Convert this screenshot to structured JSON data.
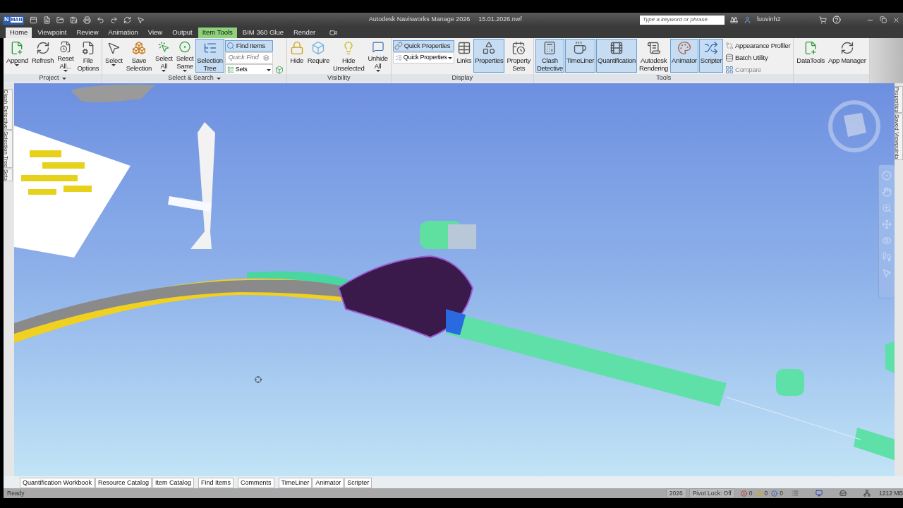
{
  "app_button": {
    "letter": "N",
    "edition": "MAN"
  },
  "window": {
    "title": "Autodesk Navisworks Manage 2026",
    "file": "15.01.2026.nwf"
  },
  "search": {
    "placeholder": "Type a keyword or phrase"
  },
  "user": {
    "name": "luuvinh2"
  },
  "tabs": [
    {
      "label": "Home",
      "selected": true,
      "kind": "normal"
    },
    {
      "label": "Viewpoint",
      "selected": false,
      "kind": "normal"
    },
    {
      "label": "Review",
      "selected": false,
      "kind": "normal"
    },
    {
      "label": "Animation",
      "selected": false,
      "kind": "normal"
    },
    {
      "label": "View",
      "selected": false,
      "kind": "normal"
    },
    {
      "label": "Output",
      "selected": false,
      "kind": "normal"
    },
    {
      "label": "Item Tools",
      "selected": false,
      "kind": "contextual"
    },
    {
      "label": "BIM 360 Glue",
      "selected": false,
      "kind": "normal"
    },
    {
      "label": "Render",
      "selected": false,
      "kind": "normal"
    }
  ],
  "ribbon_panels": [
    {
      "title": "Project",
      "menu": true,
      "items": [
        {
          "kind": "large",
          "label": "Append",
          "caret": true,
          "selected": false
        },
        {
          "kind": "large",
          "label": "Refresh",
          "selected": false
        },
        {
          "kind": "large",
          "label": "Reset\nAll...",
          "caret": true,
          "selected": false
        },
        {
          "kind": "large",
          "label": "File\nOptions",
          "selected": false
        }
      ]
    },
    {
      "title": "Select & Search",
      "menu": true,
      "items": [
        {
          "kind": "large",
          "label": "Select",
          "caret": true,
          "selected": false
        },
        {
          "kind": "large",
          "label": "Save\nSelection",
          "selected": false
        },
        {
          "kind": "large",
          "label": "Select\nAll",
          "caret": true,
          "selected": false
        },
        {
          "kind": "large",
          "label": "Select\nSame",
          "caret": true,
          "selected": false
        },
        {
          "kind": "large",
          "label": "Selection\nTree",
          "selected": true
        },
        {
          "kind": "stack",
          "items": [
            {
              "kind": "small",
              "label": "Find Items",
              "selected": true
            },
            {
              "kind": "field",
              "placeholder": "Quick Find"
            },
            {
              "kind": "dropdown",
              "label": "Sets"
            }
          ]
        },
        {
          "kind": "stack",
          "items": [
            {
              "kind": "spacer"
            },
            {
              "kind": "spacer"
            },
            {
              "kind": "icon"
            }
          ]
        }
      ]
    },
    {
      "title": "Visibility",
      "menu": false,
      "items": [
        {
          "kind": "large",
          "label": "Hide",
          "selected": false
        },
        {
          "kind": "large",
          "label": "Require",
          "selected": false
        },
        {
          "kind": "large",
          "label": "Hide\nUnselected",
          "selected": false
        },
        {
          "kind": "large",
          "label": "Unhide\nAll",
          "caret": true,
          "selected": false
        }
      ]
    },
    {
      "title": "Display",
      "menu": false,
      "items": [
        {
          "kind": "stack",
          "items": [
            {
              "kind": "small",
              "label": "Quick Properties",
              "selected": true
            },
            {
              "kind": "dropdown",
              "label": "Quick Properties"
            }
          ]
        },
        {
          "kind": "large",
          "label": "Links",
          "selected": false
        },
        {
          "kind": "large",
          "label": "Properties",
          "selected": true
        },
        {
          "kind": "large",
          "label": "Property\nSets",
          "selected": false
        }
      ]
    },
    {
      "title": "Tools",
      "menu": false,
      "items": [
        {
          "kind": "large",
          "label": "Clash\nDetective",
          "selected": true
        },
        {
          "kind": "large",
          "label": "TimeLiner",
          "selected": true
        },
        {
          "kind": "large",
          "label": "Quantification",
          "selected": true
        },
        {
          "kind": "large",
          "label": "Autodesk\nRendering",
          "selected": false
        },
        {
          "kind": "large",
          "label": "Animator",
          "selected": true
        },
        {
          "kind": "large",
          "label": "Scripter",
          "selected": true
        },
        {
          "kind": "stack",
          "items": [
            {
              "kind": "small",
              "label": "Appearance Profiler",
              "selected": false,
              "disabled": false
            },
            {
              "kind": "small",
              "label": "Batch Utility",
              "selected": false,
              "disabled": false
            },
            {
              "kind": "small",
              "label": "Compare",
              "selected": false,
              "disabled": true
            }
          ]
        }
      ]
    },
    {
      "items": [
        {
          "kind": "large",
          "label": "DataTools",
          "selected": false
        },
        {
          "kind": "large",
          "label": "App Manager",
          "selected": false
        }
      ]
    }
  ],
  "left_dock": [
    "Clash Detective",
    "Selection Tree",
    "Sets"
  ],
  "right_dock": [
    "Properties",
    "Saved Viewpoints"
  ],
  "bottom_tabs": [
    [
      "Quantification Workbook",
      "Resource Catalog",
      "Item Catalog"
    ],
    [
      "Find Items"
    ],
    [
      "Comments"
    ],
    [
      "TimeLiner",
      "Animator",
      "Scripter"
    ]
  ],
  "status_bar": {
    "message": "Ready",
    "year": "2026",
    "pivot_lock": "Pivot Lock: Off",
    "errors": "0",
    "warnings": "0",
    "infos": "0",
    "memory": "1212 MB"
  }
}
